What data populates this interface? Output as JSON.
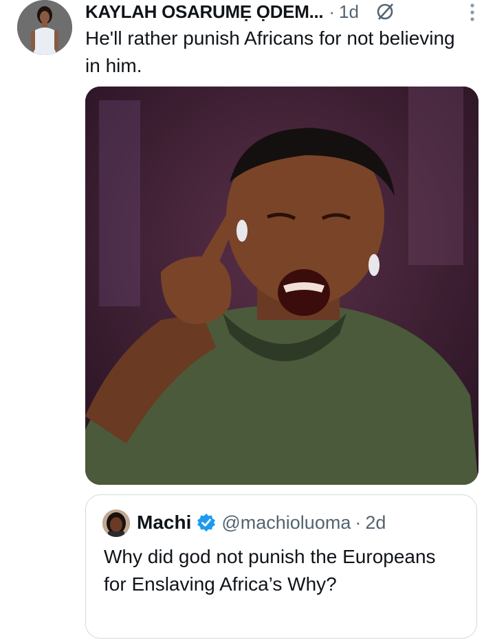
{
  "tweet": {
    "display_name": "KAYLAH OSARUMẸ ỌDEM...",
    "separator": "·",
    "time": "1d",
    "text": "He'll rather punish Africans for not believing in him.",
    "icons": {
      "avatar": "profile-photo",
      "grok": "grok-icon",
      "more": "more-vertical-icon"
    }
  },
  "quoted_tweet": {
    "display_name": "Machi",
    "handle": "@machioluoma",
    "separator": "·",
    "time": "2d",
    "text": "Why did god not punish the Europeans for Enslaving Africa’s Why?",
    "icons": {
      "avatar": "profile-photo",
      "verified": "verified-badge-icon"
    },
    "colors": {
      "verified": "#1d9bf0"
    }
  },
  "colors": {
    "text": "#0f1419",
    "muted": "#536471",
    "border": "#cfd9de"
  }
}
